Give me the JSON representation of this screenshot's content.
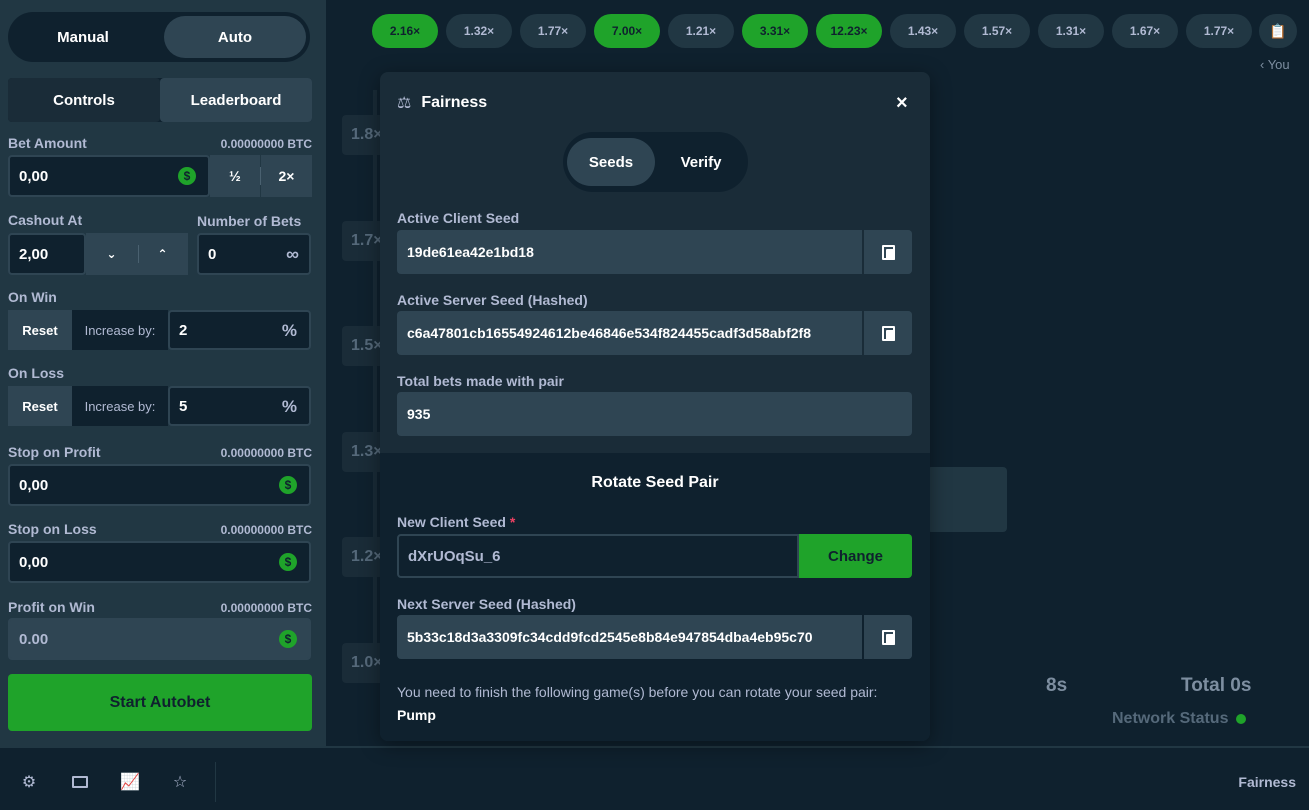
{
  "sidebar": {
    "mode": {
      "manual": "Manual",
      "auto": "Auto"
    },
    "tabs": {
      "controls": "Controls",
      "leaderboard": "Leaderboard"
    },
    "bet_amount": {
      "label": "Bet Amount",
      "btc": "0.00000000 BTC",
      "value": "0,00",
      "half": "½",
      "double": "2×"
    },
    "cashout": {
      "label": "Cashout At",
      "value": "2,00"
    },
    "num_bets": {
      "label": "Number of Bets",
      "value": "0"
    },
    "on_win": {
      "label": "On Win",
      "reset": "Reset",
      "increase": "Increase by:",
      "value": "2",
      "pct": "%"
    },
    "on_loss": {
      "label": "On Loss",
      "reset": "Reset",
      "increase": "Increase by:",
      "value": "5",
      "pct": "%"
    },
    "stop_profit": {
      "label": "Stop on Profit",
      "btc": "0.00000000 BTC",
      "value": "0,00"
    },
    "stop_loss": {
      "label": "Stop on Loss",
      "btc": "0.00000000 BTC",
      "value": "0,00"
    },
    "profit_win": {
      "label": "Profit on Win",
      "btc": "0.00000000 BTC",
      "value": "0.00"
    },
    "dollar": "$",
    "start": "Start Autobet"
  },
  "history": {
    "chips": [
      {
        "v": "2.16×",
        "win": true
      },
      {
        "v": "1.32×",
        "win": false
      },
      {
        "v": "1.77×",
        "win": false
      },
      {
        "v": "7.00×",
        "win": true
      },
      {
        "v": "1.21×",
        "win": false
      },
      {
        "v": "3.31×",
        "win": true
      },
      {
        "v": "12.23×",
        "win": true
      },
      {
        "v": "1.43×",
        "win": false
      },
      {
        "v": "1.57×",
        "win": false
      },
      {
        "v": "1.31×",
        "win": false
      },
      {
        "v": "1.67×",
        "win": false
      },
      {
        "v": "1.77×",
        "win": false
      }
    ],
    "you": "‹ You"
  },
  "axis": [
    "1.8×",
    "1.7×",
    "1.5×",
    "1.3×",
    "1.2×",
    "1.0×"
  ],
  "stats": {
    "time": "8s",
    "total": "Total 0s",
    "network": "Network Status"
  },
  "footer": {
    "fairness": "Fairness"
  },
  "modal": {
    "title": "Fairness",
    "close": "×",
    "tabs": {
      "seeds": "Seeds",
      "verify": "Verify"
    },
    "active_client": {
      "label": "Active Client Seed",
      "value": "19de61ea42e1bd18"
    },
    "active_server": {
      "label": "Active Server Seed (Hashed)",
      "value": "c6a47801cb16554924612be46846e534f824455cadf3d58abf2f8"
    },
    "total_bets": {
      "label": "Total bets made with pair",
      "value": "935"
    },
    "rotate": {
      "title": "Rotate Seed Pair",
      "new_client_label": "New Client Seed",
      "required": "*",
      "new_client_value": "dXrUOqSu_6",
      "change": "Change",
      "next_server_label": "Next Server Seed (Hashed)",
      "next_server_value": "5b33c18d3a3309fc34cdd9fcd2545e8b84e947854dba4eb95c70",
      "note_text": "You need to finish the following game(s) before you can rotate your seed pair: ",
      "note_game": "Pump"
    }
  },
  "colors": {
    "bg": "#0f212e",
    "panel": "#213743",
    "accent_green": "#1fa32a",
    "input": "#2f4553"
  }
}
